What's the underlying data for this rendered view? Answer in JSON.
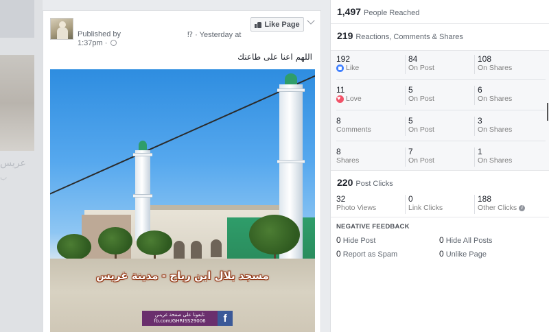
{
  "post": {
    "published_by": "Published by",
    "time_sep": "⁉ · Yesterday at",
    "time": "1:37pm ·",
    "like_page_label": "Like Page",
    "text": "اللهم اعنا على طاعتك",
    "photo_caption": "مسجد بلال ابن رباح - مدينة غريس",
    "badge_line1": "تابعونا على صفحة غريس",
    "badge_line2": "fb.com/GHRISS29006",
    "badge_icon": "f"
  },
  "background": {
    "blur_text": "عريس",
    "blur_text2": "ب"
  },
  "insights": {
    "reached": {
      "value": "1,497",
      "label": "People Reached"
    },
    "engagement": {
      "value": "219",
      "label": "Reactions, Comments & Shares"
    },
    "grid": [
      [
        {
          "n": "192",
          "l": "Like",
          "icon": "like-icon"
        },
        {
          "n": "84",
          "l": "On Post"
        },
        {
          "n": "108",
          "l": "On Shares"
        }
      ],
      [
        {
          "n": "11",
          "l": "Love",
          "icon": "love-icon"
        },
        {
          "n": "5",
          "l": "On Post"
        },
        {
          "n": "6",
          "l": "On Shares"
        }
      ],
      [
        {
          "n": "8",
          "l": "Comments"
        },
        {
          "n": "5",
          "l": "On Post"
        },
        {
          "n": "3",
          "l": "On Shares"
        }
      ],
      [
        {
          "n": "8",
          "l": "Shares"
        },
        {
          "n": "7",
          "l": "On Post"
        },
        {
          "n": "1",
          "l": "On Shares"
        }
      ]
    ],
    "post_clicks": {
      "value": "220",
      "label": "Post Clicks"
    },
    "clicks": [
      {
        "n": "32",
        "l": "Photo Views"
      },
      {
        "n": "0",
        "l": "Link Clicks"
      },
      {
        "n": "188",
        "l": "Other Clicks",
        "icon": "info-icon"
      }
    ],
    "negative_title": "NEGATIVE FEEDBACK",
    "negative": [
      {
        "n": "0",
        "l": "Hide Post"
      },
      {
        "n": "0",
        "l": "Hide All Posts"
      },
      {
        "n": "0",
        "l": "Report as Spam"
      },
      {
        "n": "0",
        "l": "Unlike Page"
      }
    ]
  },
  "colors": {
    "like_blue": "#4080ff",
    "love_red": "#f25268",
    "facebook_blue": "#3b5998"
  }
}
